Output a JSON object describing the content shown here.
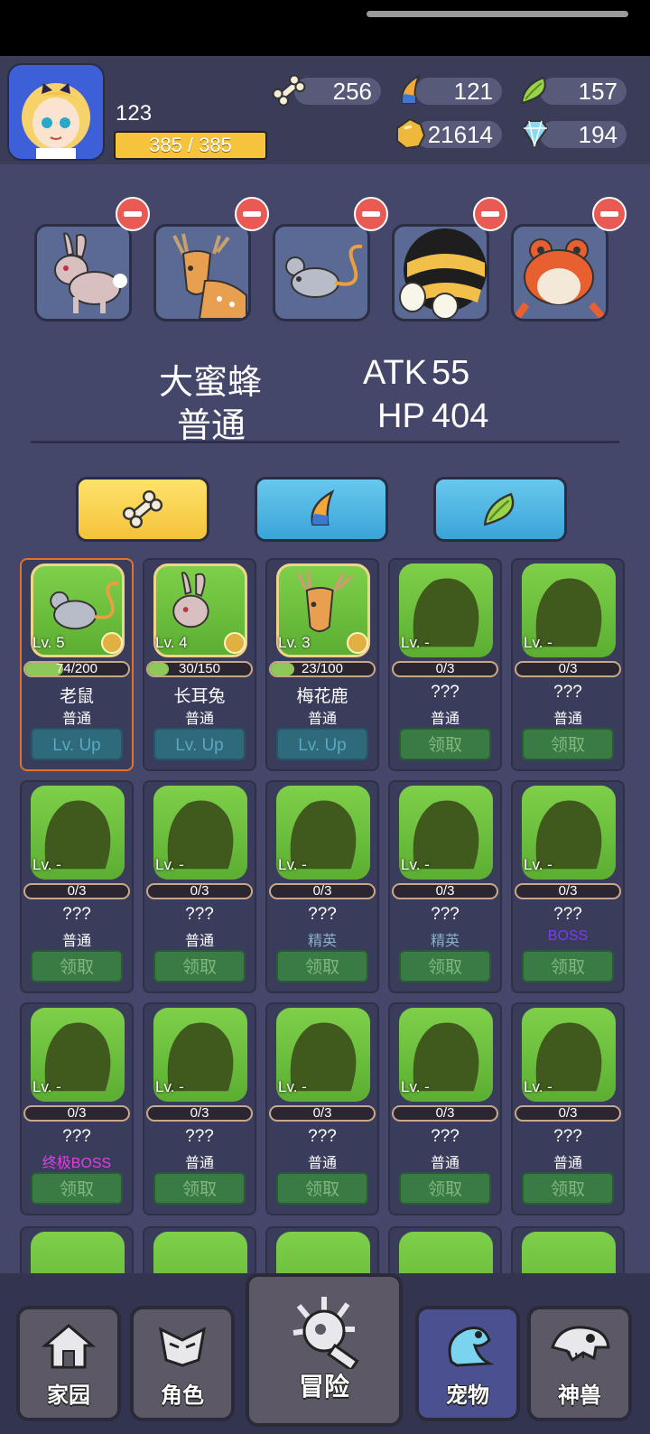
{
  "player": {
    "level": "123",
    "xp": "385 / 385"
  },
  "resources": {
    "bone": "256",
    "claw": "121",
    "feather": "157",
    "gold": "21614",
    "gem": "194"
  },
  "selected": {
    "name": "大蜜蜂",
    "rank": "普通",
    "atk_label": "ATK",
    "atk": "55",
    "hp_label": "HP",
    "hp": "404"
  },
  "team": [
    "rabbit",
    "deer",
    "mouse",
    "bee",
    "frog"
  ],
  "cards": [
    {
      "lv": "Lv. 5",
      "prog": "74/200",
      "pct": 37,
      "name": "老鼠",
      "rank": "普通",
      "btn": "Lv. Up",
      "kind": "up",
      "art": "mouse"
    },
    {
      "lv": "Lv. 4",
      "prog": "30/150",
      "pct": 20,
      "name": "长耳兔",
      "rank": "普通",
      "btn": "Lv. Up",
      "kind": "up",
      "art": "rabbit"
    },
    {
      "lv": "Lv. 3",
      "prog": "23/100",
      "pct": 23,
      "name": "梅花鹿",
      "rank": "普通",
      "btn": "Lv. Up",
      "kind": "up",
      "art": "deer"
    },
    {
      "lv": "Lv. -",
      "prog": "0/3",
      "pct": 0,
      "name": "???",
      "rank": "普通",
      "btn": "领取",
      "kind": "get",
      "art": "sil"
    },
    {
      "lv": "Lv. -",
      "prog": "0/3",
      "pct": 0,
      "name": "???",
      "rank": "普通",
      "btn": "领取",
      "kind": "get",
      "art": "sil"
    },
    {
      "lv": "Lv. -",
      "prog": "0/3",
      "pct": 0,
      "name": "???",
      "rank": "普通",
      "btn": "领取",
      "kind": "get",
      "art": "sil"
    },
    {
      "lv": "Lv. -",
      "prog": "0/3",
      "pct": 0,
      "name": "???",
      "rank": "普通",
      "btn": "领取",
      "kind": "get",
      "art": "sil"
    },
    {
      "lv": "Lv. -",
      "prog": "0/3",
      "pct": 0,
      "name": "???",
      "rank": "精英",
      "btn": "领取",
      "kind": "get",
      "art": "sil"
    },
    {
      "lv": "Lv. -",
      "prog": "0/3",
      "pct": 0,
      "name": "???",
      "rank": "精英",
      "btn": "领取",
      "kind": "get",
      "art": "sil"
    },
    {
      "lv": "Lv. -",
      "prog": "0/3",
      "pct": 0,
      "name": "???",
      "rank": "BOSS",
      "btn": "领取",
      "kind": "get",
      "art": "sil"
    },
    {
      "lv": "Lv. -",
      "prog": "0/3",
      "pct": 0,
      "name": "???",
      "rank": "终极BOSS",
      "btn": "领取",
      "kind": "get",
      "art": "sil"
    },
    {
      "lv": "Lv. -",
      "prog": "0/3",
      "pct": 0,
      "name": "???",
      "rank": "普通",
      "btn": "领取",
      "kind": "get",
      "art": "sil"
    },
    {
      "lv": "Lv. -",
      "prog": "0/3",
      "pct": 0,
      "name": "???",
      "rank": "普通",
      "btn": "领取",
      "kind": "get",
      "art": "sil"
    },
    {
      "lv": "Lv. -",
      "prog": "0/3",
      "pct": 0,
      "name": "???",
      "rank": "普通",
      "btn": "领取",
      "kind": "get",
      "art": "sil"
    },
    {
      "lv": "Lv. -",
      "prog": "0/3",
      "pct": 0,
      "name": "???",
      "rank": "普通",
      "btn": "领取",
      "kind": "get",
      "art": "sil"
    }
  ],
  "rank_colors": {
    "普通": "#ffffff",
    "精英": "#8ab0c8",
    "BOSS": "#7a3cf0",
    "终极BOSS": "#e040e0"
  },
  "nav": [
    {
      "label": "家园",
      "icon": "house-icon"
    },
    {
      "label": "角色",
      "icon": "mask-icon"
    },
    {
      "label": "冒险",
      "icon": "spiked-mace-icon"
    },
    {
      "label": "宠物",
      "icon": "frog-icon"
    },
    {
      "label": "神兽",
      "icon": "dino-skull-icon"
    }
  ]
}
